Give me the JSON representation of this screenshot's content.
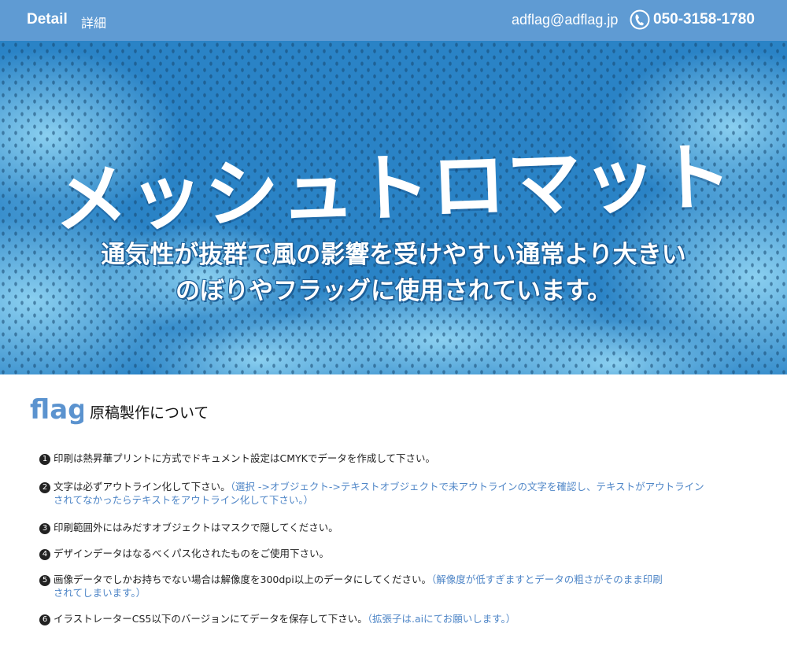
{
  "header": {
    "brand": "Detail",
    "brand_sub": "詳細",
    "email": "adflag@adflag.jp",
    "phone": "050-3158-1780"
  },
  "hero": {
    "title": "メッシュトロマット",
    "subtitle_line1": "通気性が抜群で風の影響を受けやすい通常より大きい",
    "subtitle_line2": "のぼりやフラッグに使用されています。"
  },
  "section": {
    "logo_text": "flag",
    "title": "原稿製作について"
  },
  "items": [
    {
      "num": "1",
      "text": "印刷は熱昇華プリントに方式でドキュメント設定はCMYKでデータを作成して下さい。",
      "note": "",
      "note_cont": ""
    },
    {
      "num": "2",
      "text": "文字は必ずアウトライン化して下さい。",
      "note": "（選択 ->オブジェクト->テキストオブジェクトで未アウトラインの文字を確認し、テキストがアウトライン",
      "note_cont": "されてなかったらテキストをアウトライン化して下さい。）"
    },
    {
      "num": "3",
      "text": "印刷範囲外にはみだすオブジェクトはマスクで隠してください。",
      "note": "",
      "note_cont": ""
    },
    {
      "num": "4",
      "text": "デザインデータはなるべくパス化されたものをご使用下さい。",
      "note": "",
      "note_cont": ""
    },
    {
      "num": "5",
      "text": "画像データでしかお持ちでない場合は解像度を300dpi以上のデータにしてください。",
      "note": "（解像度が低すぎますとデータの粗さがそのまま印刷",
      "note_cont": "されてしまいます。）"
    },
    {
      "num": "6",
      "text": "イラストレーターCS5以下のバージョンにてデータを保存して下さい。",
      "note": "（拡張子は.aiにてお願いします。）",
      "note_cont": ""
    }
  ],
  "colors": {
    "header_bg": "#5f9bd3",
    "accent_blue": "#4f86c7",
    "hero_blue": "#2b8bd0"
  }
}
